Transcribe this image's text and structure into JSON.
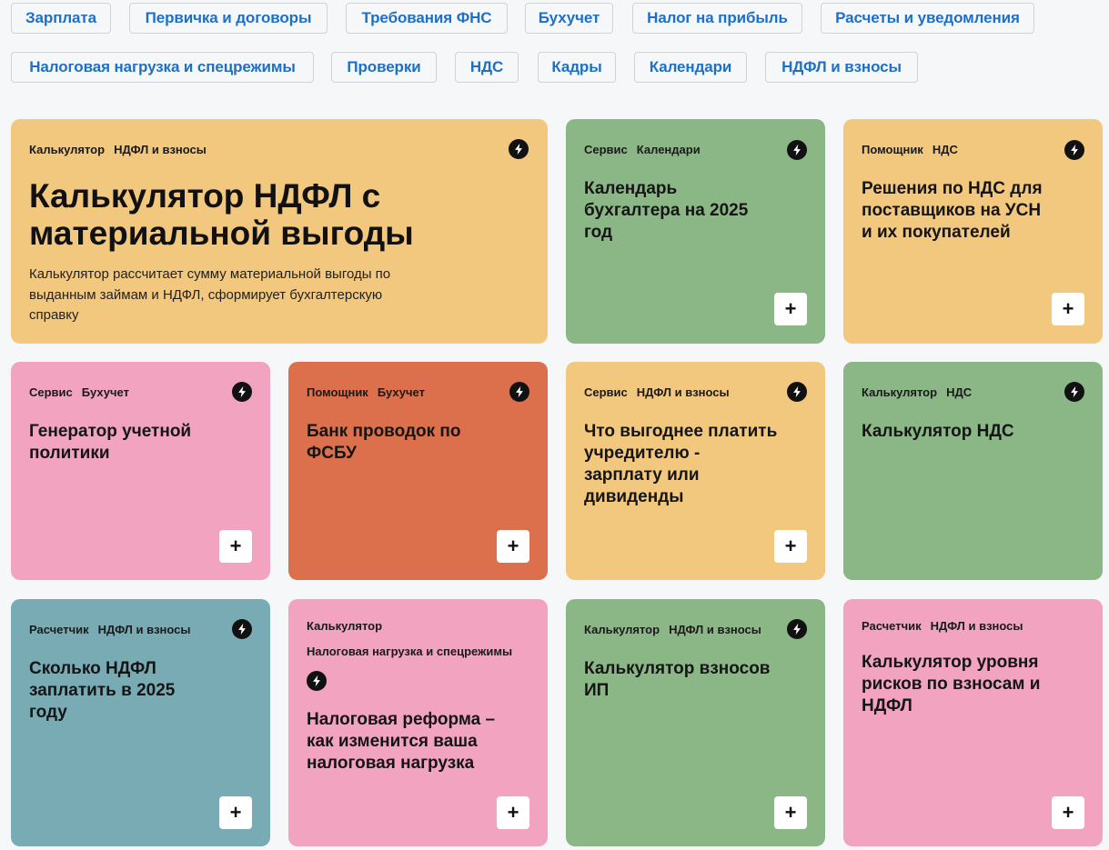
{
  "filters": [
    "Зарплата",
    "Первичка и договоры",
    "Требования ФНС",
    "Бухучет",
    "Налог на прибыль",
    "Расчеты и уведомления",
    "Налоговая нагрузка и спецрежимы",
    "Проверки",
    "НДС",
    "Кадры",
    "Календари",
    "НДФЛ и взносы"
  ],
  "cards": [
    {
      "type": "Калькулятор",
      "topic": "НДФЛ и взносы",
      "title": "Калькулятор НДФЛ с материальной выгоды",
      "desc": "Калькулятор рассчитает сумму материальной выгоды по выданным займам и НДФЛ, сформирует бухгалтерскую справку",
      "color": "#f2c77e"
    },
    {
      "type": "Сервис",
      "topic": "Календари",
      "title": "Календарь бухгалтера на 2025 год",
      "color": "#8bb787"
    },
    {
      "type": "Помощник",
      "topic": "НДС",
      "title": "Решения по НДС для поставщиков на УСН и их покупателей",
      "color": "#f2c77e"
    },
    {
      "type": "Сервис",
      "topic": "Бухучет",
      "title": "Генератор учетной политики",
      "color": "#f1a3bf"
    },
    {
      "type": "Помощник",
      "topic": "Бухучет",
      "title": "Банк проводок по ФСБУ",
      "color": "#dc6f4c"
    },
    {
      "type": "Сервис",
      "topic": "НДФЛ и взносы",
      "title": "Что выгоднее платить учредителю - зарплату или дивиденды",
      "color": "#f2c77e"
    },
    {
      "type": "Калькулятор",
      "topic": "НДС",
      "title": "Калькулятор НДС",
      "color": "#8bb787"
    },
    {
      "type": "Расчетчик",
      "topic": "НДФЛ и взносы",
      "title": "Сколько НДФЛ заплатить в 2025 году",
      "color": "#79abb5"
    },
    {
      "type": "Калькулятор",
      "topic": "Налоговая нагрузка и спецрежимы",
      "title": "Налоговая реформа – как изменится ваша налоговая нагрузка",
      "color": "#f1a3bf"
    },
    {
      "type": "Калькулятор",
      "topic": "НДФЛ и взносы",
      "title": "Калькулятор взносов ИП",
      "color": "#8bb787"
    },
    {
      "type": "Расчетчик",
      "topic": "НДФЛ и взносы",
      "title": "Калькулятор уровня рисков по взносам и НДФЛ",
      "color": "#f1a3bf"
    }
  ],
  "plus_label": "+"
}
